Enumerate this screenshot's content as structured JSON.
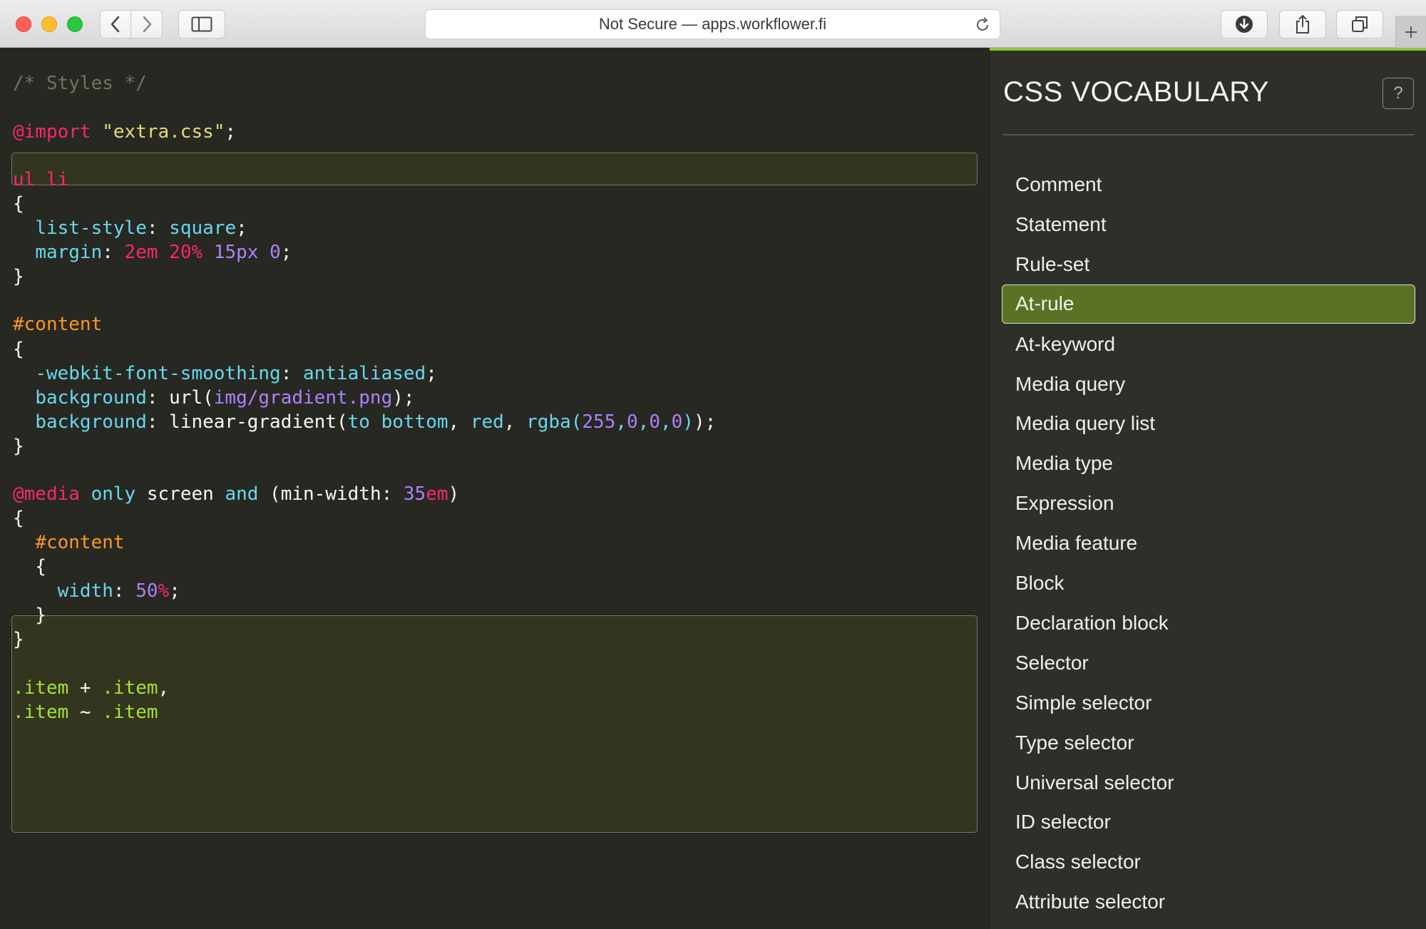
{
  "browser": {
    "url_text": "Not Secure — apps.workflower.fi",
    "icons": [
      "back-icon",
      "forward-icon",
      "sidebar-icon",
      "reload-icon",
      "download-icon",
      "share-icon",
      "tabs-icon",
      "plus-icon"
    ]
  },
  "code": {
    "lines": [
      [
        [
          "/* Styles */",
          "c-comment"
        ]
      ],
      [
        [
          "@import",
          "c-kw"
        ],
        [
          " ",
          "c-txt"
        ],
        [
          "\"extra.css\"",
          "c-str"
        ],
        [
          ";",
          "c-txt"
        ]
      ],
      [
        [
          "ul li",
          "c-kw"
        ]
      ],
      [
        [
          "{",
          "c-txt"
        ]
      ],
      [
        [
          "  ",
          "c-txt"
        ],
        [
          "list-style",
          "c-prop"
        ],
        [
          ": ",
          "c-txt"
        ],
        [
          "square",
          "c-prop"
        ],
        [
          ";",
          "c-txt"
        ]
      ],
      [
        [
          "  ",
          "c-txt"
        ],
        [
          "margin",
          "c-prop"
        ],
        [
          ": ",
          "c-txt"
        ],
        [
          "2em",
          "c-kw"
        ],
        [
          " ",
          "c-txt"
        ],
        [
          "20%",
          "c-kw"
        ],
        [
          " ",
          "c-txt"
        ],
        [
          "15px",
          "c-num"
        ],
        [
          " ",
          "c-txt"
        ],
        [
          "0",
          "c-num"
        ],
        [
          ";",
          "c-txt"
        ]
      ],
      [
        [
          "}",
          "c-txt"
        ]
      ],
      [
        [
          "#content",
          "c-id"
        ]
      ],
      [
        [
          "{",
          "c-txt"
        ]
      ],
      [
        [
          "  ",
          "c-txt"
        ],
        [
          "-webkit-font-smoothing",
          "c-prop"
        ],
        [
          ": ",
          "c-txt"
        ],
        [
          "antialiased",
          "c-prop"
        ],
        [
          ";",
          "c-txt"
        ]
      ],
      [
        [
          "  ",
          "c-txt"
        ],
        [
          "background",
          "c-prop"
        ],
        [
          ": url(",
          "c-txt"
        ],
        [
          "img/gradient.png",
          "c-num"
        ],
        [
          ");",
          "c-txt"
        ]
      ],
      [
        [
          "  ",
          "c-txt"
        ],
        [
          "background",
          "c-prop"
        ],
        [
          ": linear-gradient(",
          "c-txt"
        ],
        [
          "to bottom",
          "c-prop"
        ],
        [
          ", ",
          "c-txt"
        ],
        [
          "red",
          "c-prop"
        ],
        [
          ", ",
          "c-txt"
        ],
        [
          "rgba(",
          "c-prop"
        ],
        [
          "255",
          "c-num"
        ],
        [
          ",",
          "c-prop"
        ],
        [
          "0",
          "c-num"
        ],
        [
          ",",
          "c-prop"
        ],
        [
          "0",
          "c-num"
        ],
        [
          ",",
          "c-prop"
        ],
        [
          "0",
          "c-num"
        ],
        [
          ")",
          "c-prop"
        ],
        [
          ");",
          "c-txt"
        ]
      ],
      [
        [
          "}",
          "c-txt"
        ]
      ],
      [
        [
          "@media",
          "c-kw"
        ],
        [
          " ",
          "c-txt"
        ],
        [
          "only",
          "c-prop"
        ],
        [
          " screen ",
          "c-txt"
        ],
        [
          "and",
          "c-prop"
        ],
        [
          " (min-width: ",
          "c-txt"
        ],
        [
          "35",
          "c-num"
        ],
        [
          "em",
          "c-kw"
        ],
        [
          ")",
          "c-txt"
        ]
      ],
      [
        [
          "{",
          "c-txt"
        ]
      ],
      [
        [
          "  ",
          "c-txt"
        ],
        [
          "#content",
          "c-id"
        ]
      ],
      [
        [
          "  {",
          "c-txt"
        ]
      ],
      [
        [
          "    ",
          "c-txt"
        ],
        [
          "width",
          "c-prop"
        ],
        [
          ": ",
          "c-txt"
        ],
        [
          "50",
          "c-num"
        ],
        [
          "%",
          "c-kw"
        ],
        [
          ";",
          "c-txt"
        ]
      ],
      [
        [
          "  }",
          "c-txt"
        ]
      ],
      [
        [
          "}",
          "c-txt"
        ]
      ],
      [
        [
          ".item",
          "c-cls"
        ],
        [
          " + ",
          "c-txt"
        ],
        [
          ".item",
          "c-cls"
        ],
        [
          ",",
          "c-txt"
        ]
      ],
      [
        [
          ".item",
          "c-cls"
        ],
        [
          " ~ ",
          "c-txt"
        ],
        [
          ".item",
          "c-cls"
        ]
      ]
    ]
  },
  "sidebar": {
    "title": "CSS VOCABULARY",
    "help_label": "?",
    "active_index": 3,
    "terms": [
      "Comment",
      "Statement",
      "Rule-set",
      "At-rule",
      "At-keyword",
      "Media query",
      "Media query list",
      "Media type",
      "Expression",
      "Media feature",
      "Block",
      "Declaration block",
      "Selector",
      "Simple selector",
      "Type selector",
      "Universal selector",
      "ID selector",
      "Class selector",
      "Attribute selector"
    ]
  },
  "colors": {
    "editor_bg": "#272822",
    "sidebar_bg": "#2e2f2a",
    "active_term_bg": "#5a7226",
    "progress": "#8dc63f"
  }
}
